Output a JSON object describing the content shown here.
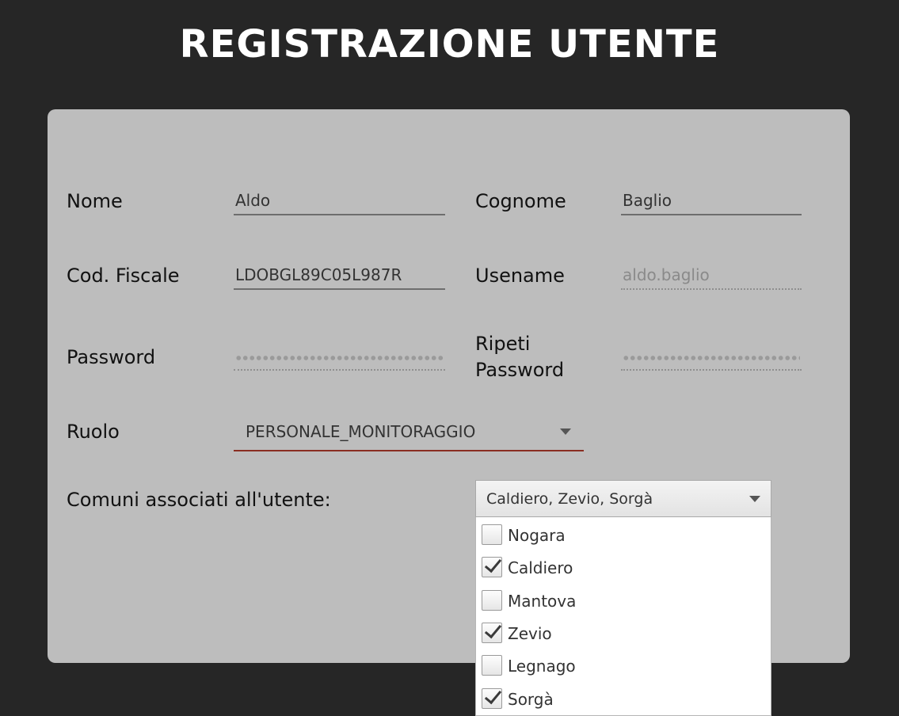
{
  "title": "REGISTRAZIONE UTENTE",
  "form": {
    "nome_label": "Nome",
    "nome_value": "Aldo",
    "cognome_label": "Cognome",
    "cognome_value": "Baglio",
    "cf_label": "Cod. Fiscale",
    "cf_value": "LDOBGL89C05L987R",
    "username_label": "Usename",
    "username_value": "aldo.baglio",
    "password_label": "Password",
    "ripeti_label_line1": "Ripeti",
    "ripeti_label_line2": "Password",
    "ruolo_label": "Ruolo",
    "ruolo_value": "PERSONALE_MONITORAGGIO",
    "comuni_label": "Comuni associati all'utente:",
    "comuni_value": "Caldiero, Zevio, Sorgà"
  },
  "comuni_options": [
    {
      "label": "Nogara",
      "checked": false
    },
    {
      "label": "Caldiero",
      "checked": true
    },
    {
      "label": "Mantova",
      "checked": false
    },
    {
      "label": "Zevio",
      "checked": true
    },
    {
      "label": "Legnago",
      "checked": false
    },
    {
      "label": "Sorgà",
      "checked": true
    }
  ],
  "colors": {
    "background": "#262626",
    "panel": "#bdbdbd",
    "ruolo_underline": "#8a2e22"
  }
}
